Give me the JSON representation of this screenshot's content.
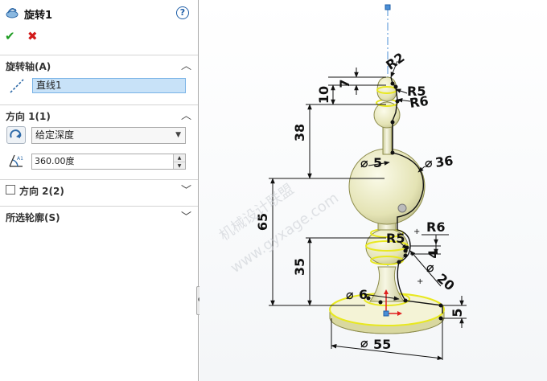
{
  "feature": {
    "title": "旋转1",
    "icon": "revolve-feature-icon",
    "help_icon": "help-icon",
    "ok_icon": "checkmark-icon",
    "cancel_icon": "close-icon"
  },
  "sections": {
    "axis": {
      "label": "旋转轴(A)",
      "value": "直线1",
      "icon": "axis-line-icon"
    },
    "direction1": {
      "label": "方向 1(1)",
      "type": "给定深度",
      "angle": "360.00度",
      "reverse_icon": "reverse-direction-icon",
      "angle_icon": "angle-icon"
    },
    "direction2": {
      "label": "方向 2(2)",
      "checked": false
    },
    "contours": {
      "label": "所选轮廓(S)"
    }
  },
  "sketch": {
    "dimensions": {
      "r2": "R2",
      "d7": "7",
      "d10": "10",
      "r5_top": "R5",
      "r6_top": "R6",
      "d38": "38",
      "dia5": "5",
      "dia36": "36",
      "d65": "65",
      "r6_mid": "R6",
      "r5_mid": "R5",
      "d4": "4",
      "d35": "35",
      "dia20": "20",
      "dia6": "6",
      "d5": "5",
      "dia55": "55"
    },
    "watermark_cn": "机械设计联盟",
    "watermark_url": "www.gyxage.com",
    "colors": {
      "body": "#f1f0c6",
      "highlight": "#e8e820",
      "axis": "#4a8fd6",
      "dimension": "#111111"
    }
  }
}
